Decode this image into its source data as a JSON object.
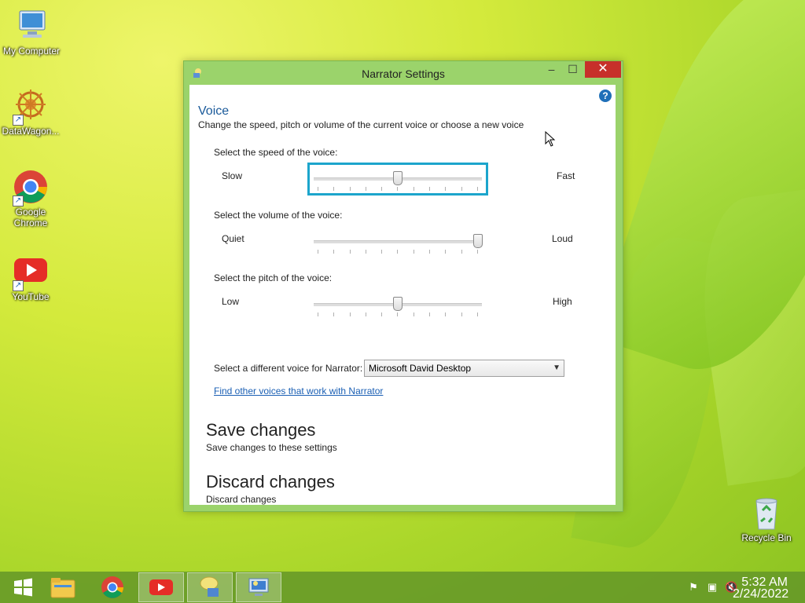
{
  "desktop": {
    "icons": [
      {
        "label": "My Computer"
      },
      {
        "label": "DataWagon..."
      },
      {
        "label": "Google Chrome"
      },
      {
        "label": "YouTube"
      },
      {
        "label": "Recycle Bin"
      }
    ]
  },
  "window": {
    "title": "Narrator Settings",
    "minimize": "–",
    "maximize": "☐",
    "close": "✕",
    "help": "?",
    "voice": {
      "title": "Voice",
      "description": "Change the speed, pitch or volume of the current voice or choose a new voice",
      "speed": {
        "label": "Select the speed of the voice:",
        "min_label": "Slow",
        "max_label": "Fast",
        "value": 0.5
      },
      "volume": {
        "label": "Select the volume of the voice:",
        "min_label": "Quiet",
        "max_label": "Loud",
        "value": 1.0
      },
      "pitch": {
        "label": "Select the pitch of the voice:",
        "min_label": "Low",
        "max_label": "High",
        "value": 0.5
      },
      "voice_select_label": "Select a different voice for Narrator:",
      "voice_select_value": "Microsoft David Desktop",
      "find_voices_link": "Find other voices that work with Narrator"
    },
    "save": {
      "title": "Save changes",
      "description": "Save changes to these settings"
    },
    "discard": {
      "title": "Discard changes",
      "description": "Discard changes"
    }
  },
  "taskbar": {
    "clock_time": "5:32 AM",
    "clock_date": "2/24/2022"
  },
  "colors": {
    "accent_focus": "#1ca5cc",
    "link": "#1a5fb4",
    "close_button": "#c7302a"
  }
}
